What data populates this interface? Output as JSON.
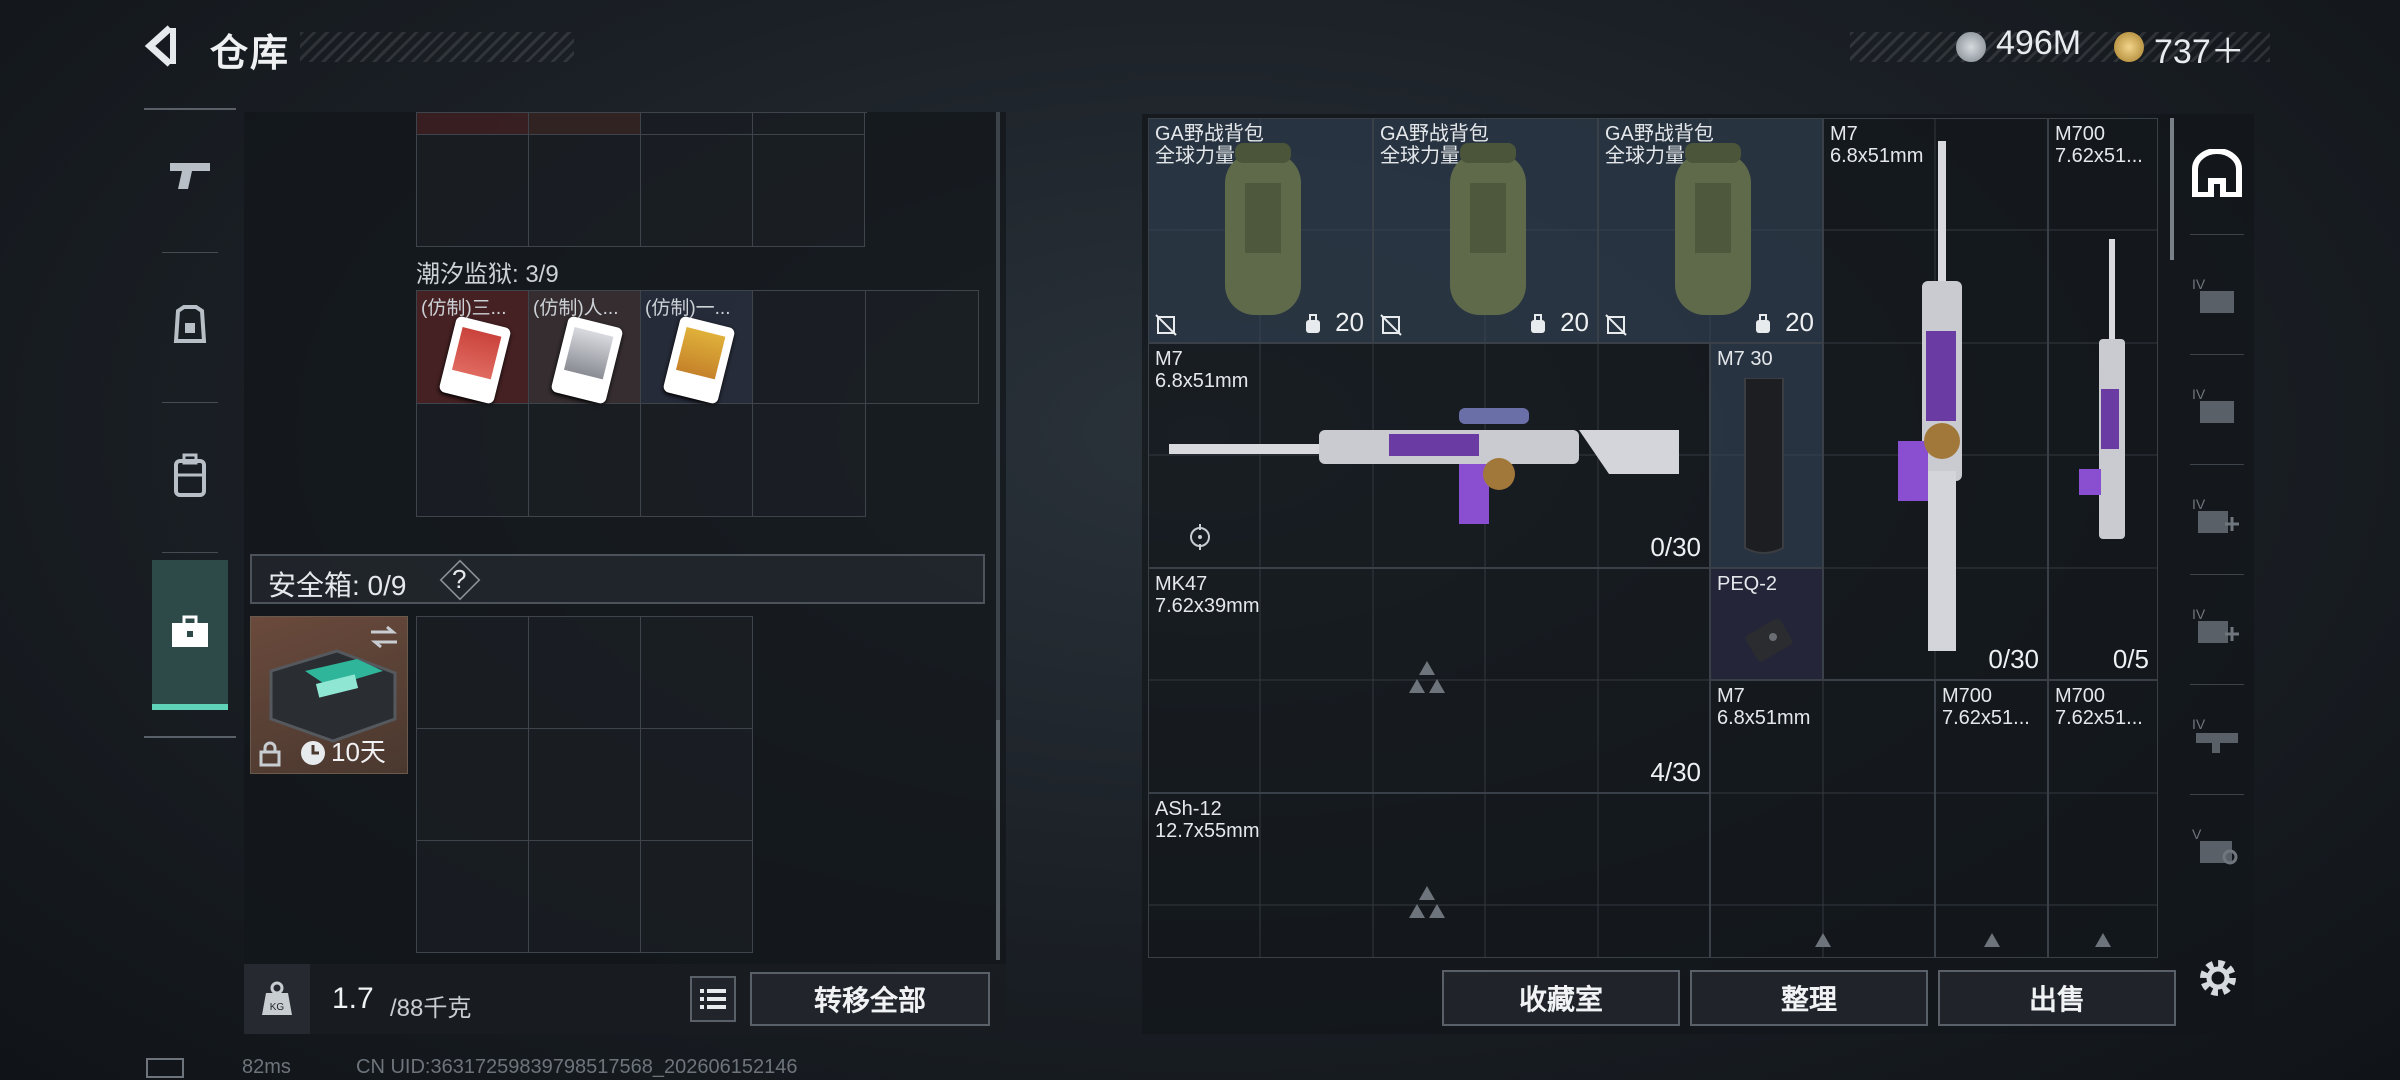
{
  "header": {
    "back_icon": "back-arrow-icon",
    "title": "仓库"
  },
  "currency": [
    {
      "icon": "silver-coin-icon",
      "value": "496M",
      "color": "#a8aeb4"
    },
    {
      "icon": "gold-coin-icon",
      "value": "737＋",
      "color": "#d8b25a"
    }
  ],
  "nav": [
    {
      "icon": "gun-icon",
      "name": "weapons"
    },
    {
      "icon": "armor-icon",
      "name": "armor"
    },
    {
      "icon": "backpack-icon",
      "name": "backpack"
    },
    {
      "icon": "toolbox-icon",
      "name": "safe-box",
      "active": true
    }
  ],
  "left": {
    "section_prison": {
      "label": "潮汐监狱: 3/9",
      "items": [
        "(仿制)三...",
        "(仿制)人...",
        "(仿制)一..."
      ]
    },
    "safe_box": {
      "label": "安全箱: 0/9",
      "help": "?",
      "timer": "10天"
    },
    "weight": {
      "current": "1.7",
      "max": "/88千克"
    },
    "transfer_all": "转移全部"
  },
  "stash": {
    "backpacks": [
      {
        "name": "GA野战背包\n全球力量",
        "count": "20"
      },
      {
        "name": "GA野战背包\n全球力量",
        "count": "20"
      },
      {
        "name": "GA野战背包\n全球力量",
        "count": "20"
      }
    ],
    "items": [
      {
        "key": "m7_vertical",
        "name": "M7\n6.8x51mm",
        "count": "0/30"
      },
      {
        "key": "m700_vertical",
        "name": "M700\n7.62x51...",
        "count": "0/5"
      },
      {
        "key": "m7_main",
        "name": "M7\n6.8x51mm",
        "count": "0/30"
      },
      {
        "key": "m7_mag",
        "name": "M7 30",
        "count": ""
      },
      {
        "key": "peq2",
        "name": "PEQ-2",
        "count": ""
      },
      {
        "key": "mk47",
        "name": "MK47\n7.62x39mm",
        "count": "4/30"
      },
      {
        "key": "m7_b",
        "name": "M7\n6.8x51mm",
        "count": ""
      },
      {
        "key": "m700_b",
        "name": "M700\n7.62x51...",
        "count": ""
      },
      {
        "key": "m700_c",
        "name": "M700\n7.62x51...",
        "count": ""
      },
      {
        "key": "ash12",
        "name": "ASh-12\n12.7x55mm",
        "count": ""
      }
    ]
  },
  "bottom_buttons": [
    "收藏室",
    "整理",
    "出售"
  ],
  "side_icons": [
    "stash-home-icon",
    "stash-level4-icon",
    "stash-level4b-icon",
    "stash-add-icon",
    "stash-add-b-icon",
    "stash-weapon-icon",
    "stash-level5-icon",
    "settings-gear-icon"
  ],
  "footer": {
    "ping": "82ms",
    "uid": "CN UID:3631725983979851​7568_202606152146"
  }
}
